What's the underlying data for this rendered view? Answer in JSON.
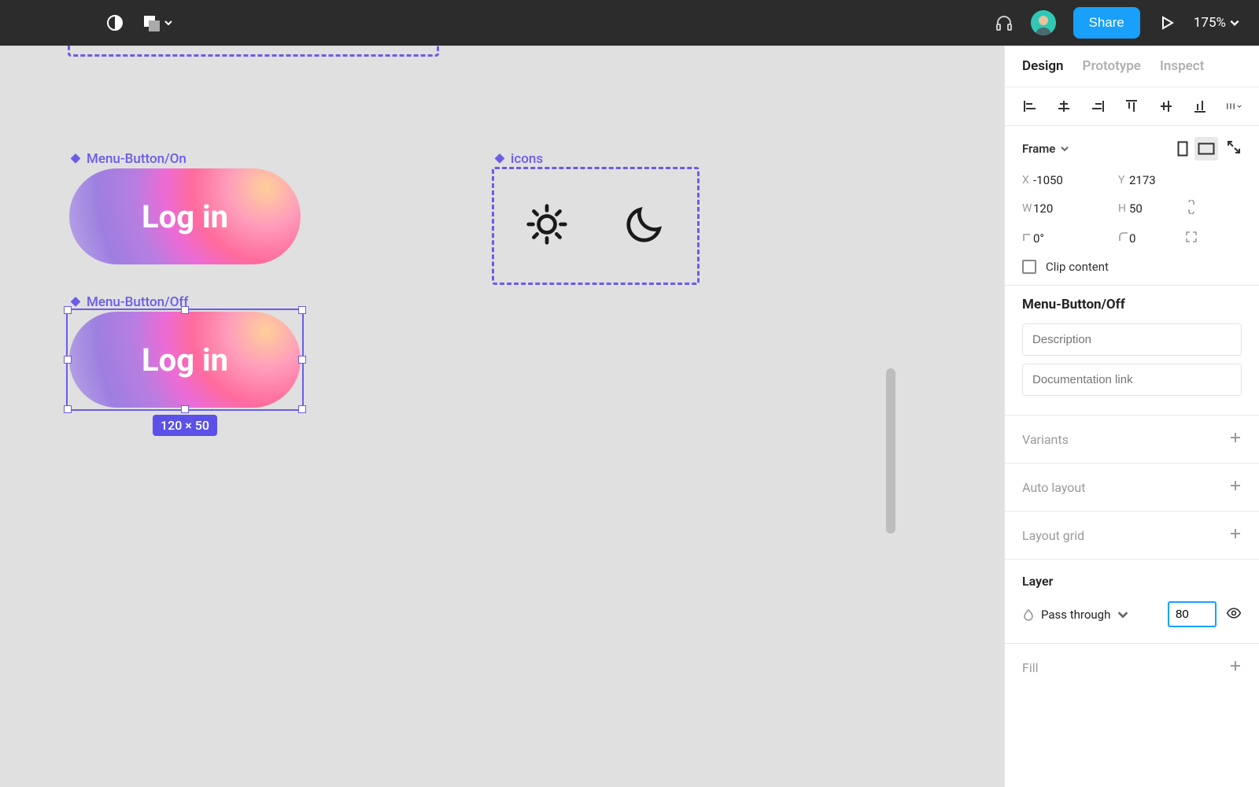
{
  "topbar": {
    "share_label": "Share",
    "zoom_label": "175%"
  },
  "canvas": {
    "menu_on_label": "Menu-Button/On",
    "menu_off_label": "Menu-Button/Off",
    "icons_label": "icons",
    "login_text_1": "Log in",
    "login_text_2": "Log in",
    "dimensions_badge": "120 × 50"
  },
  "panel": {
    "tabs": {
      "design": "Design",
      "prototype": "Prototype",
      "inspect": "Inspect"
    },
    "frame": {
      "label": "Frame",
      "x": "-1050",
      "y": "2173",
      "w": "120",
      "h": "50",
      "rot": "0°",
      "radius": "0",
      "clip_label": "Clip content"
    },
    "component": {
      "name": "Menu-Button/Off",
      "desc_placeholder": "Description",
      "docs_placeholder": "Documentation link"
    },
    "variants_label": "Variants",
    "auto_layout_label": "Auto layout",
    "layout_grid_label": "Layout grid",
    "layer": {
      "title": "Layer",
      "blend": "Pass through",
      "opacity": "80"
    },
    "fill_label": "Fill"
  }
}
